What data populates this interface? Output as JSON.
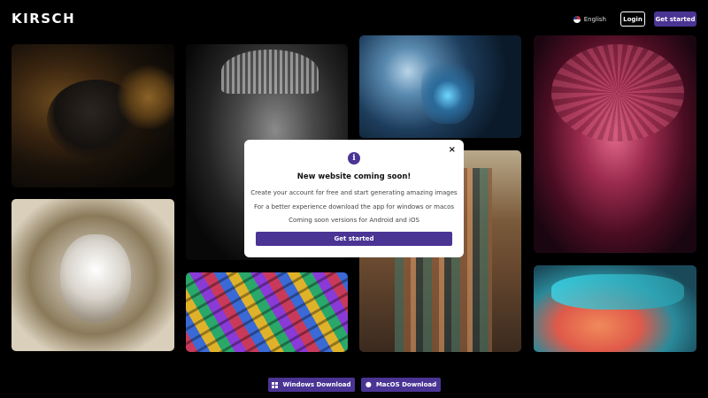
{
  "header": {
    "logo": "KIRSCH",
    "language": "English",
    "login_label": "Login",
    "get_started_label": "Get started"
  },
  "gallery": {
    "images": [
      {
        "name": "bee-macro"
      },
      {
        "name": "tribal-man-portrait"
      },
      {
        "name": "blue-knight-fantasy"
      },
      {
        "name": "geisha-umbrella"
      },
      {
        "name": "white-wolf-ornate"
      },
      {
        "name": "colorful-houses"
      },
      {
        "name": "futuristic-city"
      },
      {
        "name": "anime-cyber-girl"
      }
    ]
  },
  "modal": {
    "icon": "info-icon",
    "close": "×",
    "title": "New website coming soon!",
    "line1": "Create your account for free and start generating amazing images",
    "line2": "For a better experience download the app for windows or macos",
    "line3": "Coming soon versions for Android and iOS",
    "button_label": "Get started"
  },
  "downloads": {
    "windows_label": "Windows Download",
    "macos_label": "MacOS Download"
  },
  "colors": {
    "accent": "#4a3494",
    "background": "#000000"
  }
}
